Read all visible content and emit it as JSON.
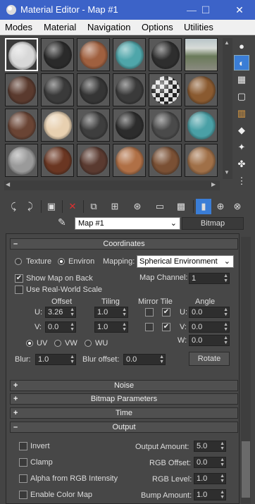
{
  "window": {
    "title": "Material Editor - Map #1",
    "min": "—",
    "max": "☐",
    "close": "✕"
  },
  "menu": [
    "Modes",
    "Material",
    "Navigation",
    "Options",
    "Utilities"
  ],
  "map_name": "Map #1",
  "map_type": "Bitmap",
  "rollouts": {
    "coordinates": "Coordinates",
    "noise": "Noise",
    "bitmap_params": "Bitmap Parameters",
    "time": "Time",
    "output": "Output"
  },
  "coords": {
    "texture": "Texture",
    "environ": "Environ",
    "mapping_label": "Mapping:",
    "mapping_value": "Spherical Environment",
    "show_map": "Show Map on Back",
    "map_channel_label": "Map Channel:",
    "map_channel": "1",
    "real_world": "Use Real-World Scale",
    "offset_h": "Offset",
    "tiling_h": "Tiling",
    "mirror_tile_h": "Mirror Tile",
    "angle_h": "Angle",
    "u": "U:",
    "v": "V:",
    "w": "W:",
    "u_offset": "3.26",
    "v_offset": "0.0",
    "u_tiling": "1.0",
    "v_tiling": "1.0",
    "u_angle": "0.0",
    "v_angle": "0.0",
    "w_angle": "0.0",
    "uv": "UV",
    "vw": "VW",
    "wu": "WU",
    "blur_label": "Blur:",
    "blur": "1.0",
    "blur_offset_label": "Blur offset:",
    "blur_offset": "0.0",
    "rotate": "Rotate"
  },
  "output": {
    "invert": "Invert",
    "clamp": "Clamp",
    "alpha": "Alpha from RGB Intensity",
    "color_map": "Enable Color Map",
    "output_amount_label": "Output Amount:",
    "output_amount": "5.0",
    "rgb_offset_label": "RGB Offset:",
    "rgb_offset": "0.0",
    "rgb_level_label": "RGB Level:",
    "rgb_level": "1.0",
    "bump_label": "Bump Amount:",
    "bump": "1.0"
  },
  "slot_colors": [
    "#d8d8d8",
    "#2a2a2a",
    "#a0603f",
    "#4fa6aa",
    "#2e2e2e",
    "photo",
    "#5a3a2e",
    "#3a3a3a",
    "#353535",
    "#3a3a3a",
    "checker",
    "#8a5a30",
    "#6a4434",
    "#e8d0b0",
    "#3e3e3e",
    "#2c2c2c",
    "#4a4a4a",
    "#4aa0a6",
    "#9a9a9a",
    "#6a3622",
    "#5a3a30",
    "#b07046",
    "#7a5034",
    "#a07048"
  ]
}
